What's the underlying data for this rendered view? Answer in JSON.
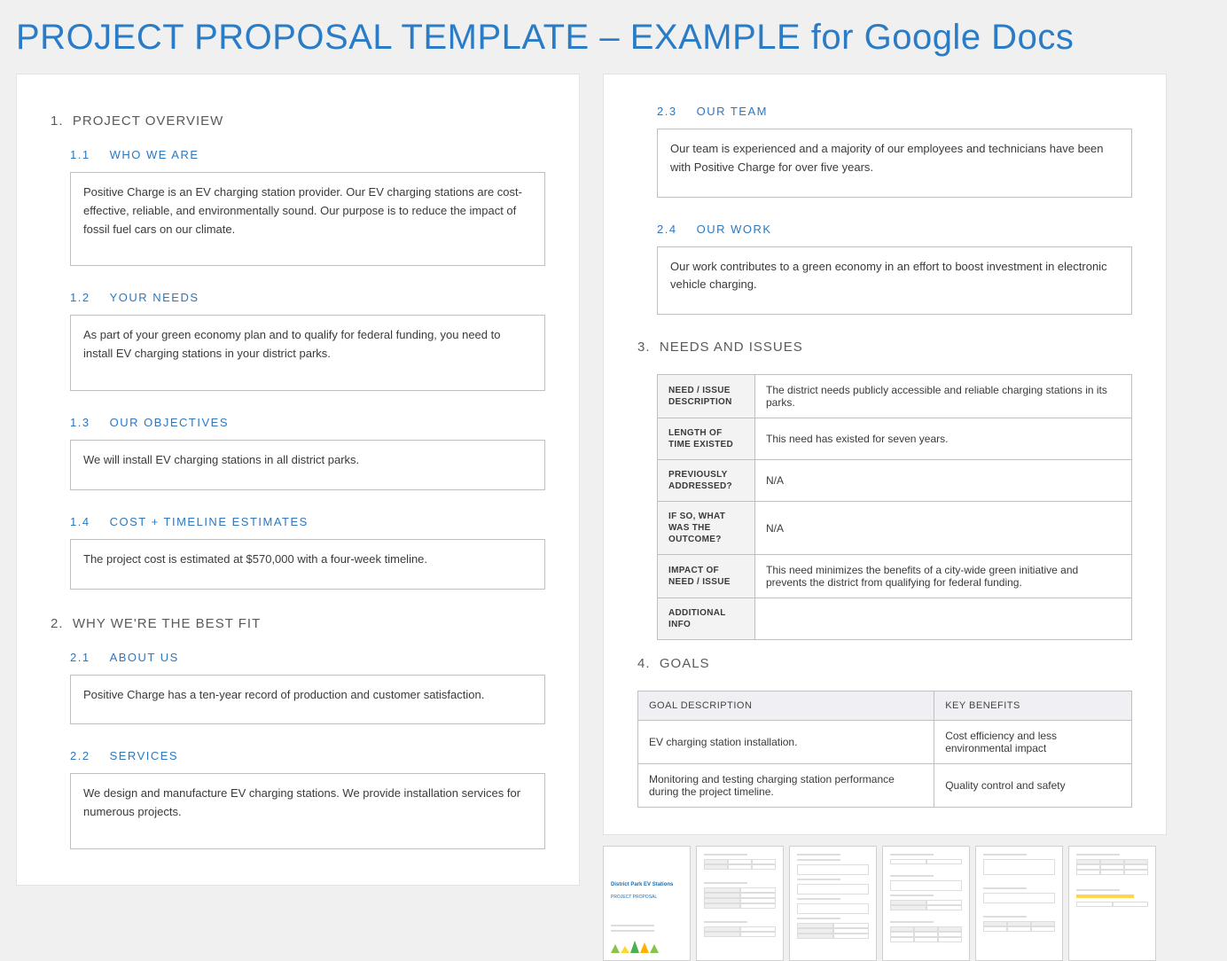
{
  "mainTitle": "PROJECT PROPOSAL TEMPLATE – EXAMPLE for Google Docs",
  "page1": {
    "s1": {
      "num": "1.",
      "title": "PROJECT OVERVIEW"
    },
    "s1_1": {
      "num": "1.1",
      "title": "WHO WE ARE",
      "body": "Positive Charge is an EV charging station provider. Our EV charging stations are cost-effective, reliable, and environmentally sound. Our purpose is to reduce the impact of fossil fuel cars on our climate."
    },
    "s1_2": {
      "num": "1.2",
      "title": "YOUR NEEDS",
      "body": "As part of your green economy plan and to qualify for federal funding, you need to install EV charging stations in your district parks."
    },
    "s1_3": {
      "num": "1.3",
      "title": "OUR OBJECTIVES",
      "body": "We will install EV charging stations in all district parks."
    },
    "s1_4": {
      "num": "1.4",
      "title": "COST + TIMELINE ESTIMATES",
      "body": "The project cost is estimated at $570,000 with a four-week timeline."
    },
    "s2": {
      "num": "2.",
      "title": "WHY WE'RE THE BEST FIT"
    },
    "s2_1": {
      "num": "2.1",
      "title": "ABOUT US",
      "body": "Positive Charge has a ten-year record of production and customer satisfaction."
    },
    "s2_2": {
      "num": "2.2",
      "title": "SERVICES",
      "body": "We design and manufacture EV charging stations. We provide installation services for numerous projects."
    }
  },
  "page2": {
    "s2_3": {
      "num": "2.3",
      "title": "OUR TEAM",
      "body": "Our team is experienced and a majority of our employees and technicians have been with Positive Charge for over five years."
    },
    "s2_4": {
      "num": "2.4",
      "title": "OUR WORK",
      "body": "Our work contributes to a green economy in an effort to boost investment in electronic vehicle charging."
    },
    "s3": {
      "num": "3.",
      "title": "NEEDS AND ISSUES"
    },
    "needs": {
      "row1": {
        "label": "NEED / ISSUE DESCRIPTION",
        "value": "The district needs publicly accessible and reliable charging stations in its parks."
      },
      "row2": {
        "label": "LENGTH OF TIME EXISTED",
        "value": "This need has existed for seven years."
      },
      "row3": {
        "label": "PREVIOUSLY ADDRESSED?",
        "value": "N/A"
      },
      "row4": {
        "label": "IF SO, WHAT WAS THE OUTCOME?",
        "value": "N/A"
      },
      "row5": {
        "label": "IMPACT OF NEED / ISSUE",
        "value": "This need minimizes the benefits of a city-wide green initiative and prevents the district from qualifying for federal funding."
      },
      "row6": {
        "label": "ADDITIONAL INFO",
        "value": ""
      }
    },
    "s4": {
      "num": "4.",
      "title": "GOALS"
    },
    "goals": {
      "header": {
        "c1": "GOAL DESCRIPTION",
        "c2": "KEY BENEFITS"
      },
      "r1": {
        "c1": "EV charging station installation.",
        "c2": "Cost efficiency and less environmental impact"
      },
      "r2": {
        "c1": "Monitoring and testing charging station performance during the project timeline.",
        "c2": "Quality control and safety"
      }
    }
  },
  "thumbs": {
    "t1": {
      "title": "District Park EV Stations",
      "sub": "PROJECT PROPOSAL"
    }
  }
}
